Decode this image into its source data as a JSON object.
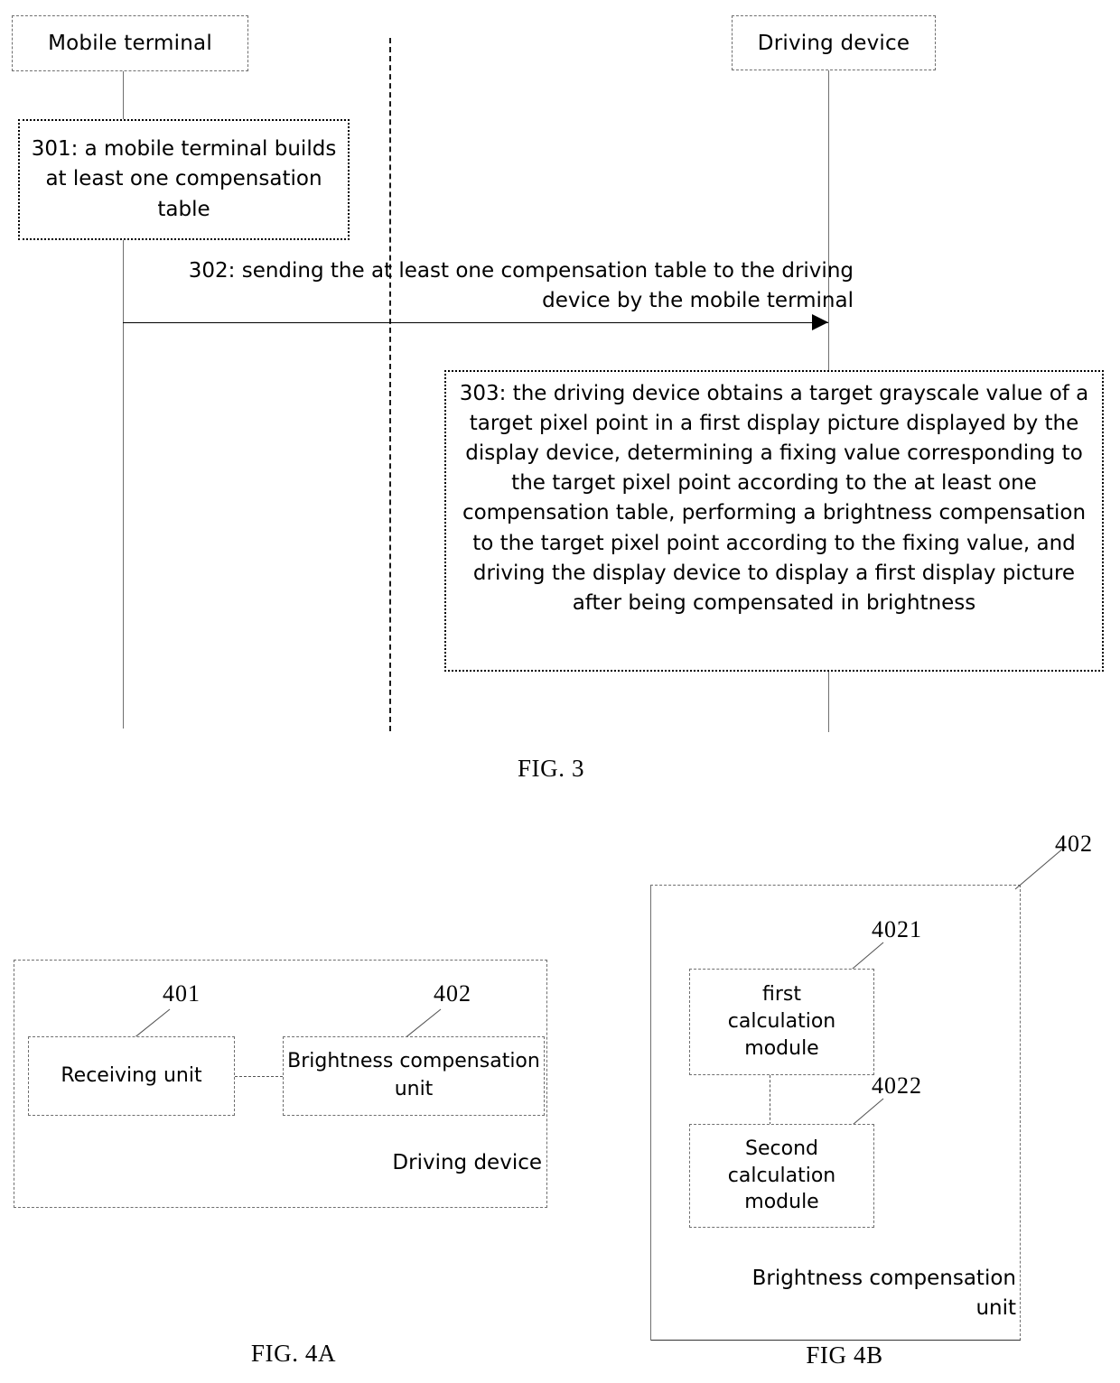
{
  "figures": {
    "fig3": {
      "caption": "FIG. 3",
      "actors": [
        {
          "id": "mobile-terminal",
          "label": "Mobile terminal"
        },
        {
          "id": "driving-device",
          "label": "Driving device"
        }
      ],
      "steps": [
        {
          "id": "301",
          "text": "301: a mobile terminal builds at least one compensation table"
        },
        {
          "id": "303",
          "text": "303: the driving device obtains a target grayscale value of a target pixel point in a first display picture displayed by the display device, determining a fixing value corresponding to the target pixel point according to the at least one compensation table, performing a brightness compensation to the target pixel point according to the fixing value, and driving the display device to display a first display picture after being compensated in brightness"
        }
      ],
      "messages": [
        {
          "id": "302",
          "text": "302: sending the at least one compensation table to the driving device by the mobile terminal",
          "from": "mobile-terminal",
          "to": "driving-device"
        }
      ]
    },
    "fig4a": {
      "caption": "FIG. 4A",
      "container_label": "Driving device",
      "units": [
        {
          "ref": "401",
          "label": "Receiving unit"
        },
        {
          "ref": "402",
          "label": "Brightness compensation unit"
        }
      ]
    },
    "fig4b": {
      "caption": "FIG 4B",
      "container_ref": "402",
      "container_label": "Brightness compensation unit",
      "modules": [
        {
          "ref": "4021",
          "label": "first calculation module"
        },
        {
          "ref": "4022",
          "label": "Second calculation module"
        }
      ]
    }
  },
  "colors": {
    "ink": "#000000",
    "line_gray": "#6f6f6f",
    "page_bg": "#ffffff"
  }
}
